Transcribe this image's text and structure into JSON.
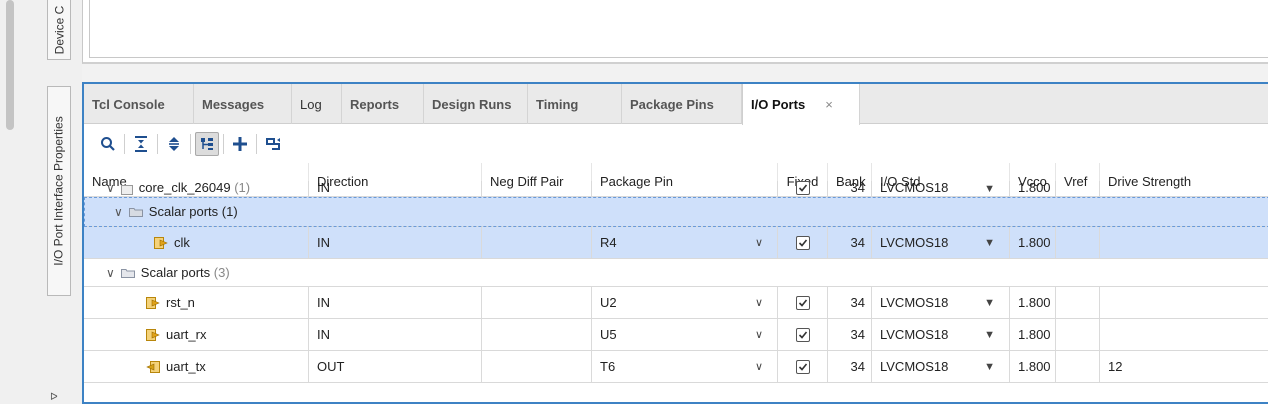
{
  "side_tabs": {
    "device": "Device C",
    "io_props": "I/O Port Interface Properties"
  },
  "tabs": [
    {
      "label": "Tcl Console"
    },
    {
      "label": "Messages"
    },
    {
      "label": "Log"
    },
    {
      "label": "Reports"
    },
    {
      "label": "Design Runs"
    },
    {
      "label": "Timing"
    },
    {
      "label": "Package Pins"
    },
    {
      "label": "I/O Ports",
      "close": "×"
    }
  ],
  "toolbar_icons": [
    "search-icon",
    "collapse-all-icon",
    "expand-all-icon",
    "group-by-interface-icon",
    "add-icon",
    "auto-assign-icon"
  ],
  "columns": {
    "name": "Name",
    "direction": "Direction",
    "neg_diff_pair": "Neg Diff Pair",
    "package_pin": "Package Pin",
    "fixed": "Fixed",
    "bank": "Bank",
    "io_std": "I/O Std",
    "vcco": "Vcco",
    "vref": "Vref",
    "drive_strength": "Drive Strength"
  },
  "rows": {
    "core_clk": {
      "name": "core_clk_26049",
      "count": "(1)",
      "direction": "IN",
      "fixed": true,
      "bank": "34",
      "io_std": "LVCMOS18",
      "vcco": "1.800"
    },
    "scalar_group_1": {
      "name": "Scalar ports",
      "count": "(1)"
    },
    "clk": {
      "name": "clk",
      "direction": "IN",
      "package_pin": "R4",
      "fixed": true,
      "bank": "34",
      "io_std": "LVCMOS18",
      "vcco": "1.800"
    },
    "scalar_group_3": {
      "name": "Scalar ports",
      "count": "(3)"
    },
    "rst_n": {
      "name": "rst_n",
      "direction": "IN",
      "package_pin": "U2",
      "fixed": true,
      "bank": "34",
      "io_std": "LVCMOS18",
      "vcco": "1.800"
    },
    "uart_rx": {
      "name": "uart_rx",
      "direction": "IN",
      "package_pin": "U5",
      "fixed": true,
      "bank": "34",
      "io_std": "LVCMOS18",
      "vcco": "1.800"
    },
    "uart_tx": {
      "name": "uart_tx",
      "direction": "OUT",
      "package_pin": "T6",
      "fixed": true,
      "bank": "34",
      "io_std": "LVCMOS18",
      "vcco": "1.800",
      "drive_strength": "12"
    }
  },
  "colors": {
    "accent_border": "#3d82c4",
    "selection": "#cfe0fa",
    "port_in": "#e0a21a",
    "port_out": "#d4a017"
  }
}
